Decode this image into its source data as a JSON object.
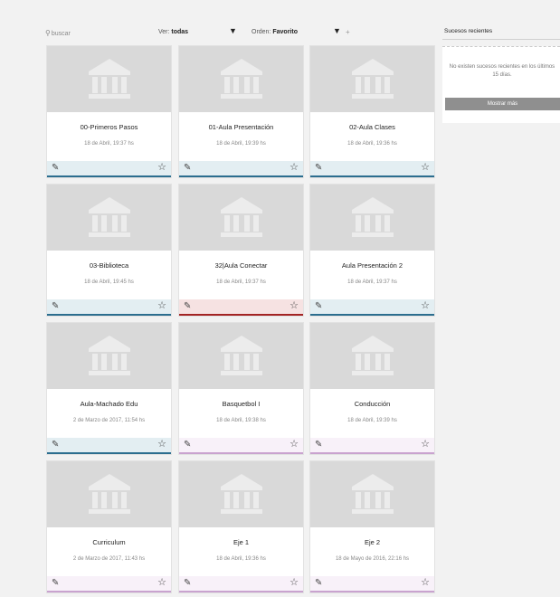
{
  "toolbar": {
    "search_placeholder": "buscar",
    "view_label": "Ver:",
    "view_value": "todas",
    "order_label": "Orden:",
    "order_value": "Favorito",
    "add_symbol": "+"
  },
  "right_panel": {
    "title": "Sucesos recientes",
    "message": "No existen sucesos recientes en los últimos 15 días.",
    "button": "Mostrar más"
  },
  "courses": [
    {
      "title": "00-Primeros Pasos",
      "date": "18 de Abril, 19:37 hs",
      "color": "#2c6e8f",
      "bg": "#e3eef2"
    },
    {
      "title": "01-Aula Presentación",
      "date": "18 de Abril, 19:39 hs",
      "color": "#2c6e8f",
      "bg": "#e3eef2"
    },
    {
      "title": "02-Aula Clases",
      "date": "18 de Abril, 19:36 hs",
      "color": "#2c6e8f",
      "bg": "#e3eef2"
    },
    {
      "title": "03-Biblioteca",
      "date": "18 de Abril, 19:45 hs",
      "color": "#2c6e8f",
      "bg": "#e3eef2"
    },
    {
      "title": "32|Aula Conectar",
      "date": "18 de Abril, 19:37 hs",
      "color": "#a32424",
      "bg": "#f6e2e2"
    },
    {
      "title": "Aula Presentación 2",
      "date": "18 de Abril, 19:37 hs",
      "color": "#2c6e8f",
      "bg": "#e3eef2"
    },
    {
      "title": "Aula-Machado Edu",
      "date": "2 de Marzo de 2017, 11:54 hs",
      "color": "#2c6e8f",
      "bg": "#e3eef2"
    },
    {
      "title": "Basquetbol I",
      "date": "18 de Abril, 19:38 hs",
      "color": "#c9a3cf",
      "bg": "#f8f1f9"
    },
    {
      "title": "Conducción",
      "date": "18 de Abril, 19:39 hs",
      "color": "#c9a3cf",
      "bg": "#f8f1f9"
    },
    {
      "title": "Curriculum",
      "date": "2 de Marzo de 2017, 11:43 hs",
      "color": "#c9a3cf",
      "bg": "#f8f1f9"
    },
    {
      "title": "Eje 1",
      "date": "18 de Abril, 19:36 hs",
      "color": "#c9a3cf",
      "bg": "#f8f1f9"
    },
    {
      "title": "Eje 2",
      "date": "18 de Mayo de 2016, 22:16 hs",
      "color": "#c9a3cf",
      "bg": "#f8f1f9"
    }
  ],
  "icons": {
    "thumb": "institution-icon",
    "edit": "edit-icon",
    "favorite": "star-outline-icon",
    "sort": "triangle-down-icon"
  }
}
